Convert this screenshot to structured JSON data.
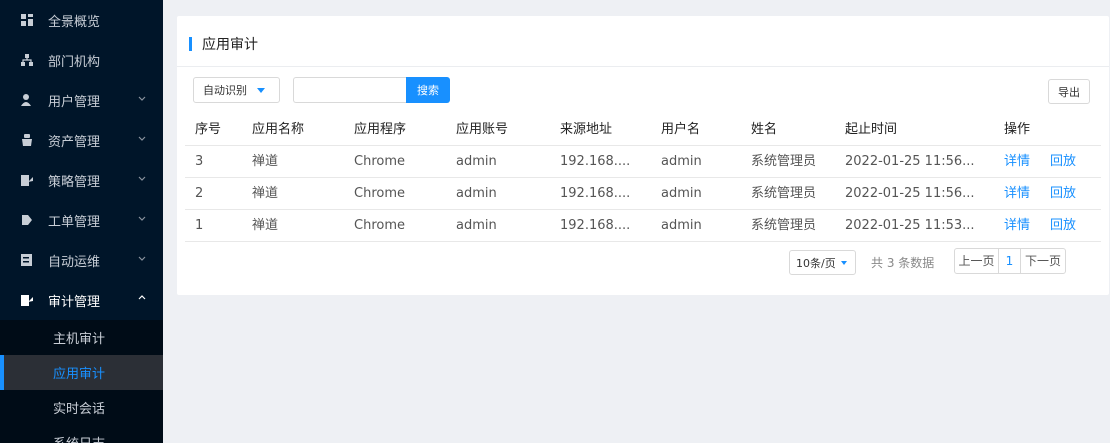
{
  "sidebar": {
    "items": [
      {
        "label": "全景概览",
        "icon": "dashboard-icon",
        "has_arrow": false
      },
      {
        "label": "部门机构",
        "icon": "org-tree-icon",
        "has_arrow": false
      },
      {
        "label": "用户管理",
        "icon": "user-icon",
        "has_arrow": true
      },
      {
        "label": "资产管理",
        "icon": "asset-icon",
        "has_arrow": true
      },
      {
        "label": "策略管理",
        "icon": "policy-icon",
        "has_arrow": true
      },
      {
        "label": "工单管理",
        "icon": "ticket-icon",
        "has_arrow": true
      },
      {
        "label": "自动运维",
        "icon": "automation-icon",
        "has_arrow": true
      },
      {
        "label": "审计管理",
        "icon": "audit-icon",
        "has_arrow": true,
        "open": true
      }
    ],
    "audit_sub": [
      {
        "label": "主机审计"
      },
      {
        "label": "应用审计",
        "active": true
      },
      {
        "label": "实时会话"
      },
      {
        "label": "系统日志"
      }
    ]
  },
  "panel": {
    "title": "应用审计",
    "filter_select": "自动识别",
    "search_value": "",
    "search_button": "搜索",
    "export_button": "导出"
  },
  "table": {
    "headers": [
      "序号",
      "应用名称",
      "应用程序",
      "应用账号",
      "来源地址",
      "用户名",
      "姓名",
      "起止时间",
      "操作"
    ],
    "rows": [
      {
        "no": "3",
        "app_name": "禅道",
        "program": "Chrome",
        "account": "admin",
        "source": "192.168....",
        "username": "admin",
        "name": "系统管理员",
        "time": "2022-01-25 11:56...",
        "detail": "详情",
        "replay": "回放"
      },
      {
        "no": "2",
        "app_name": "禅道",
        "program": "Chrome",
        "account": "admin",
        "source": "192.168....",
        "username": "admin",
        "name": "系统管理员",
        "time": "2022-01-25 11:56...",
        "detail": "详情",
        "replay": "回放"
      },
      {
        "no": "1",
        "app_name": "禅道",
        "program": "Chrome",
        "account": "admin",
        "source": "192.168....",
        "username": "admin",
        "name": "系统管理员",
        "time": "2022-01-25 11:53...",
        "detail": "详情",
        "replay": "回放"
      }
    ]
  },
  "pagination": {
    "page_size": "10条/页",
    "total": "共 3 条数据",
    "prev": "上一页",
    "current": "1",
    "next": "下一页"
  },
  "colors": {
    "sidebar_bg": "#001529",
    "accent": "#1890ff",
    "page_bg": "#eef0f4"
  }
}
